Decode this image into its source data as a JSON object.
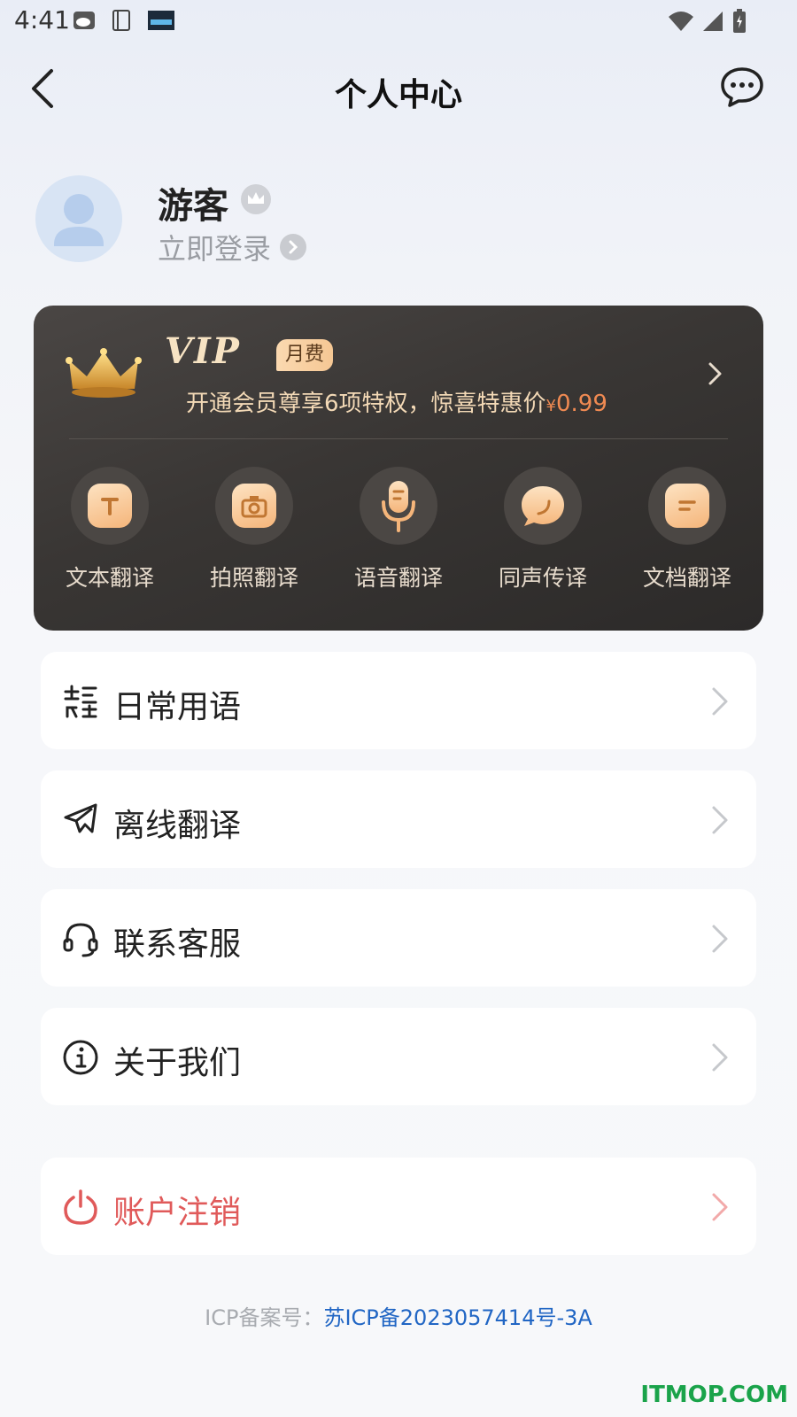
{
  "status_bar": {
    "time": "4:41",
    "notif_icons": [
      "weibo-icon",
      "notebook-icon",
      "clock-widget-icon"
    ],
    "right_icons": [
      "wifi-icon",
      "signal-icon",
      "battery-icon"
    ]
  },
  "header": {
    "title": "个人中心",
    "back_icon": "chevron-left-icon",
    "message_icon": "chat-bubble-icon"
  },
  "profile": {
    "name": "游客",
    "login_text": "立即登录",
    "badge_icon": "crown-icon"
  },
  "vip": {
    "logo": "VIP",
    "tag": "月费",
    "desc": "开通会员尊享6项特权，惊喜特惠价",
    "price_symbol": "¥",
    "price": "0.99",
    "features": [
      {
        "label": "文本翻译",
        "icon": "text-t-icon"
      },
      {
        "label": "拍照翻译",
        "icon": "camera-icon"
      },
      {
        "label": "语音翻译",
        "icon": "microphone-icon"
      },
      {
        "label": "同声传译",
        "icon": "speech-bubble-icon"
      },
      {
        "label": "文档翻译",
        "icon": "document-icon"
      }
    ]
  },
  "menu": [
    {
      "label": "日常用语",
      "icon": "translate-phrases-icon"
    },
    {
      "label": "离线翻译",
      "icon": "airplane-icon"
    },
    {
      "label": "联系客服",
      "icon": "headset-icon"
    },
    {
      "label": "关于我们",
      "icon": "info-icon"
    }
  ],
  "logout": {
    "label": "账户注销",
    "icon": "power-icon",
    "color": "#e05a5a"
  },
  "icp": {
    "prefix": "ICP备案号：",
    "number": "苏ICP备2023057414号-3A"
  },
  "watermark": "ITMOP.COM",
  "colors": {
    "vip_gold": "#f3d9b6",
    "price_orange": "#f08a52",
    "link_blue": "#2166c4"
  }
}
